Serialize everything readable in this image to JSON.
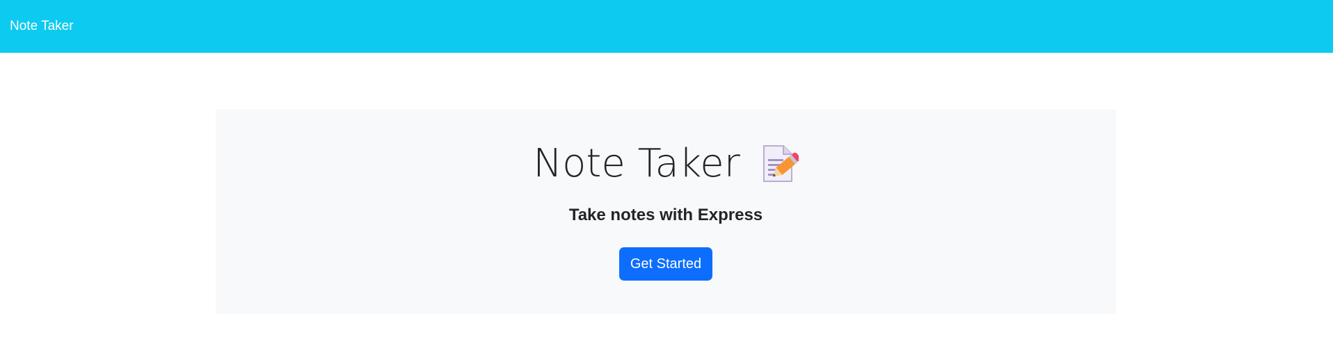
{
  "navbar": {
    "brand": "Note Taker",
    "background_color": "#0dcaf0"
  },
  "hero": {
    "title": "Note Taker",
    "icon": "memo-icon",
    "subtitle": "Take notes with Express",
    "button_label": "Get Started",
    "button_color": "#0d6efd",
    "panel_color": "#f8f9fa"
  }
}
